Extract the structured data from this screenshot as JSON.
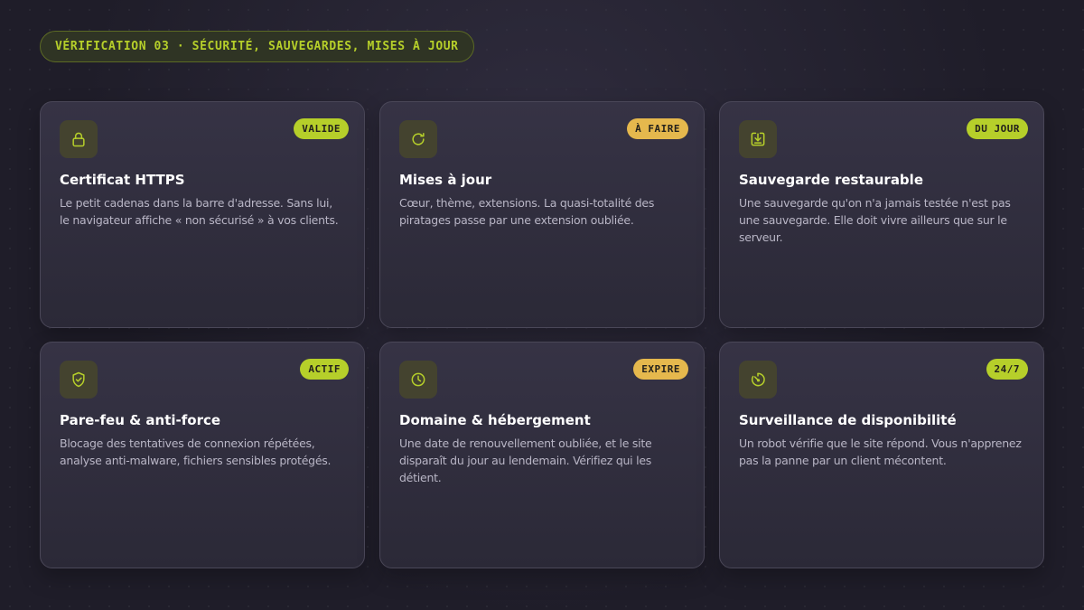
{
  "header": {
    "label": "VÉRIFICATION 03 · SÉCURITÉ, SAUVEGARDES, MISES À JOUR"
  },
  "colors": {
    "accent": "#b6cf2a",
    "warning": "#e5b84d",
    "background": "#1f1d29",
    "card": "#312e3e"
  },
  "cards": [
    {
      "icon": "lock-icon",
      "status": "VALIDE",
      "status_color": "green",
      "title": "Certificat HTTPS",
      "description": "Le petit cadenas dans la barre d'adresse. Sans lui, le navigateur affiche « non sécurisé » à vos clients."
    },
    {
      "icon": "refresh-icon",
      "status": "À FAIRE",
      "status_color": "amber",
      "title": "Mises à jour",
      "description": "Cœur, thème, extensions. La quasi-totalité des piratages passe par une extension oubliée."
    },
    {
      "icon": "download-box-icon",
      "status": "DU JOUR",
      "status_color": "green",
      "title": "Sauvegarde restaurable",
      "description": "Une sauvegarde qu'on n'a jamais testée n'est pas une sauvegarde. Elle doit vivre ailleurs que sur le serveur."
    },
    {
      "icon": "shield-check-icon",
      "status": "ACTIF",
      "status_color": "green",
      "title": "Pare-feu & anti-force",
      "description": "Blocage des tentatives de connexion répétées, analyse anti-malware, fichiers sensibles protégés."
    },
    {
      "icon": "clock-icon",
      "status": "EXPIRE",
      "status_color": "amber",
      "title": "Domaine & hébergement",
      "description": "Une date de renouvellement oubliée, et le site disparaît du jour au lendemain. Vérifiez qui les détient."
    },
    {
      "icon": "gauge-icon",
      "status": "24/7",
      "status_color": "green",
      "title": "Surveillance de disponibilité",
      "description": "Un robot vérifie que le site répond. Vous n'apprenez pas la panne par un client mécontent."
    }
  ]
}
